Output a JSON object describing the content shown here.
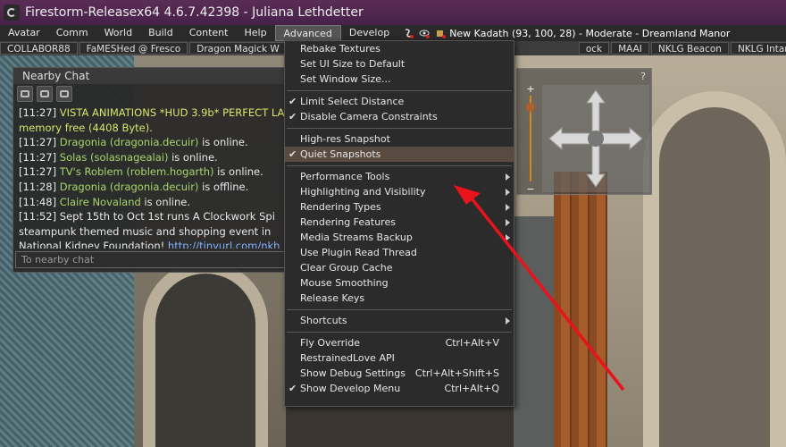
{
  "window": {
    "title": "Firestorm-Releasex64 4.6.7.42398 - Juliana Lethdetter"
  },
  "menubar": {
    "items": [
      "Avatar",
      "Comm",
      "World",
      "Build",
      "Content",
      "Help",
      "Advanced",
      "Develop"
    ],
    "active": "Advanced",
    "location": "New Kadath (93, 100, 28) - Moderate - Dreamland Manor"
  },
  "favorites": [
    "COLLABOR88",
    "FaMESHed @ Fresco",
    "Dragon Magick W",
    "ock",
    "MAAI",
    "NKLG Beacon",
    "NKLG Intan Room"
  ],
  "favorites_more": "»",
  "chat": {
    "title": "Nearby Chat",
    "lines": [
      {
        "ts": "[11:27]",
        "name": "VISTA ANIMATIONS *HUD 3.9b* PERFECT LA",
        "rest": "",
        "kind": "hl"
      },
      {
        "ts": "",
        "name": "",
        "rest": "memory free (4408 Byte).",
        "kind": "hl"
      },
      {
        "ts": "[11:27]",
        "name": "Dragonia (dragonia.decuir)",
        "rest": " is online.",
        "kind": "nm"
      },
      {
        "ts": "[11:27]",
        "name": "Solas (solasnagealai)",
        "rest": " is online.",
        "kind": "nm"
      },
      {
        "ts": "[11:27]",
        "name": "TV's Roblem (roblem.hogarth)",
        "rest": " is online.",
        "kind": "nm"
      },
      {
        "ts": "[11:28]",
        "name": "Dragonia (dragonia.decuir)",
        "rest": " is offline.",
        "kind": "nm"
      },
      {
        "ts": "[11:48]",
        "name": "Claire Novaland",
        "rest": " is online.",
        "kind": "nm"
      },
      {
        "ts": "[11:52]",
        "name": "",
        "rest": "Sept 15th to Oct 1st runs A Clockwork Spi",
        "kind": "plain"
      },
      {
        "ts": "",
        "name": "",
        "rest": "steampunk themed music and shopping event in",
        "kind": "plain"
      },
      {
        "ts": "",
        "name": "",
        "rest": "National Kidney Foundation! ",
        "kind": "link",
        "link": "http://tinyurl.com/nkh"
      }
    ],
    "input_placeholder": "To nearby chat"
  },
  "camera": {
    "help": "?",
    "plus": "+",
    "minus": "−"
  },
  "advanced_menu": [
    {
      "type": "item",
      "label": "Rebake Textures"
    },
    {
      "type": "item",
      "label": "Set UI Size to Default"
    },
    {
      "type": "item",
      "label": "Set Window Size..."
    },
    {
      "type": "sep"
    },
    {
      "type": "item",
      "label": "Limit Select Distance",
      "check": true
    },
    {
      "type": "item",
      "label": "Disable Camera Constraints",
      "check": true
    },
    {
      "type": "sep"
    },
    {
      "type": "item",
      "label": "High-res Snapshot"
    },
    {
      "type": "item",
      "label": "Quiet Snapshots",
      "check": true,
      "hover": true
    },
    {
      "type": "sep"
    },
    {
      "type": "item",
      "label": "Performance Tools",
      "sub": true
    },
    {
      "type": "item",
      "label": "Highlighting and Visibility",
      "sub": true
    },
    {
      "type": "item",
      "label": "Rendering Types",
      "sub": true
    },
    {
      "type": "item",
      "label": "Rendering Features",
      "sub": true
    },
    {
      "type": "item",
      "label": "Media Streams Backup",
      "sub": true
    },
    {
      "type": "item",
      "label": "Use Plugin Read Thread"
    },
    {
      "type": "item",
      "label": "Clear Group Cache"
    },
    {
      "type": "item",
      "label": "Mouse Smoothing"
    },
    {
      "type": "item",
      "label": "Release Keys"
    },
    {
      "type": "sep"
    },
    {
      "type": "item",
      "label": "Shortcuts",
      "sub": true
    },
    {
      "type": "sep"
    },
    {
      "type": "item",
      "label": "Fly Override",
      "shortcut": "Ctrl+Alt+V"
    },
    {
      "type": "item",
      "label": "RestrainedLove API"
    },
    {
      "type": "item",
      "label": "Show Debug Settings",
      "shortcut": "Ctrl+Alt+Shift+S"
    },
    {
      "type": "item",
      "label": "Show Develop Menu",
      "shortcut": "Ctrl+Alt+Q",
      "check": true
    }
  ],
  "colors": {
    "annotation_arrow": "#e8131b",
    "menu_hover": "#5a4b42",
    "title_bar": "#4f2750"
  }
}
